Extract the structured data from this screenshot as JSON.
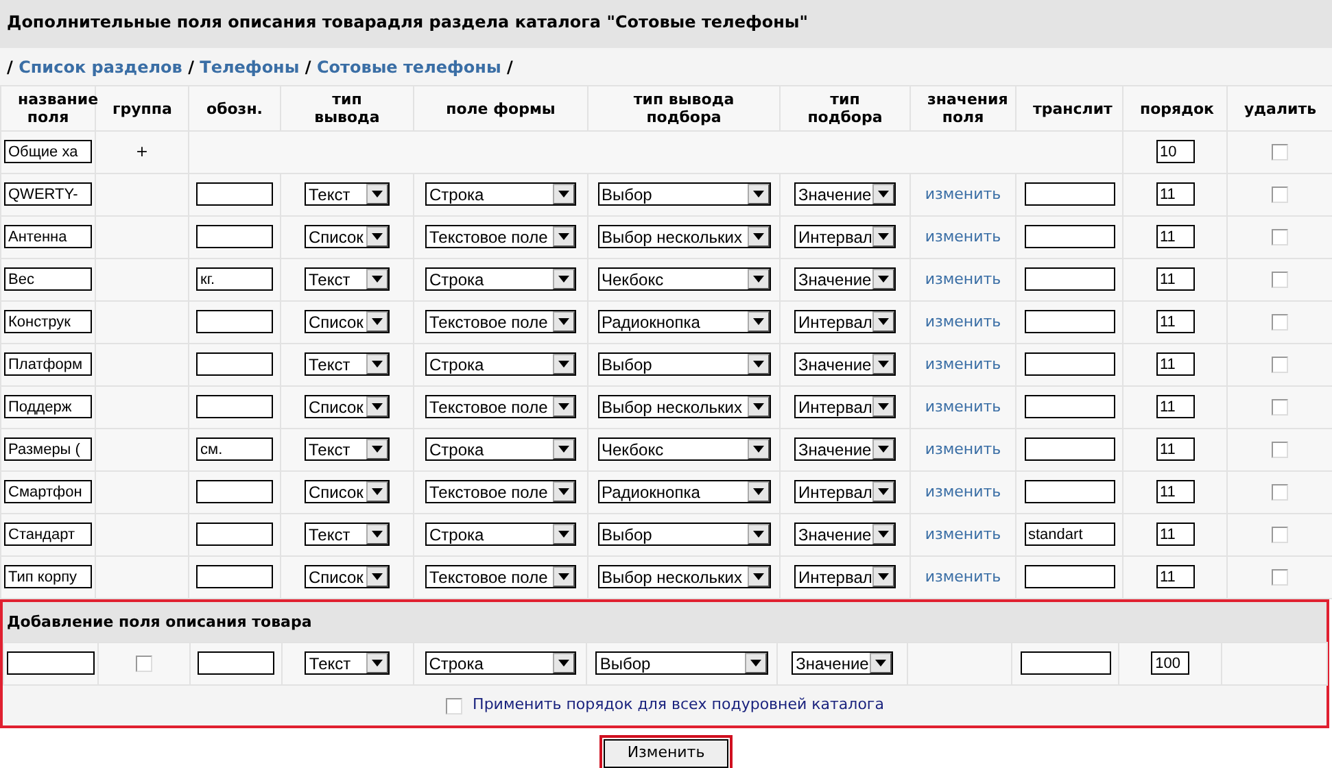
{
  "title": "Дополнительные поля описания товарадля раздела каталога \"Сотовые телефоны\"",
  "breadcrumb": [
    "Список разделов",
    "Телефоны",
    "Сотовые телефоны"
  ],
  "breadcrumb_separator": "/",
  "columns": [
    "название поля",
    "группа",
    "обозн.",
    "тип вывода",
    "поле формы",
    "тип вывода подбора",
    "тип подбора",
    "значения поля",
    "транслит",
    "порядок",
    "удалить"
  ],
  "group_row": {
    "name": "Общие ха",
    "marker": "+",
    "order": "10",
    "delete": false
  },
  "rows": [
    {
      "name": "QWERTY-",
      "output_type": "Текст",
      "form_field": "Строка",
      "filter_output": "Выбор",
      "filter_type": "Значение",
      "values_link": "изменить",
      "order": "11",
      "delete": false
    },
    {
      "name": "Антенна",
      "output_type": "Список",
      "form_field": "Текстовое поле",
      "filter_output": "Выбор нескольких",
      "filter_type": "Интервал",
      "values_link": "изменить",
      "order": "11",
      "delete": false
    },
    {
      "name": "Вес",
      "unit": "кг.",
      "output_type": "Текст",
      "form_field": "Строка",
      "filter_output": "Чекбокс",
      "filter_type": "Значение",
      "values_link": "изменить",
      "order": "11",
      "delete": false
    },
    {
      "name": "Конструк",
      "output_type": "Список",
      "form_field": "Текстовое поле",
      "filter_output": "Радиокнопка",
      "filter_type": "Интервал",
      "values_link": "изменить",
      "order": "11",
      "delete": false
    },
    {
      "name": "Платформ",
      "output_type": "Текст",
      "form_field": "Строка",
      "filter_output": "Выбор",
      "filter_type": "Значение",
      "values_link": "изменить",
      "order": "11",
      "delete": false
    },
    {
      "name": "Поддерж",
      "output_type": "Список",
      "form_field": "Текстовое поле",
      "filter_output": "Выбор нескольких",
      "filter_type": "Интервал",
      "values_link": "изменить",
      "order": "11",
      "delete": false
    },
    {
      "name": "Размеры (",
      "unit": "см.",
      "output_type": "Текст",
      "form_field": "Строка",
      "filter_output": "Чекбокс",
      "filter_type": "Значение",
      "values_link": "изменить",
      "order": "11",
      "delete": false
    },
    {
      "name": "Смартфон",
      "output_type": "Список",
      "form_field": "Текстовое поле",
      "filter_output": "Радиокнопка",
      "filter_type": "Интервал",
      "values_link": "изменить",
      "order": "11",
      "delete": false
    },
    {
      "name": "Стандарт",
      "output_type": "Текст",
      "form_field": "Строка",
      "filter_output": "Выбор",
      "filter_type": "Значение",
      "values_link": "изменить",
      "translit": "standart",
      "order": "11",
      "delete": false
    },
    {
      "name": "Тип корпу",
      "output_type": "Список",
      "form_field": "Текстовое поле",
      "filter_output": "Выбор нескольких",
      "filter_type": "Интервал",
      "values_link": "изменить",
      "order": "11",
      "delete": false
    }
  ],
  "add_section": {
    "title": "Добавление поля описания товара",
    "row": {
      "group": false,
      "output_type": "Текст",
      "form_field": "Строка",
      "filter_output": "Выбор",
      "filter_type": "Значение",
      "order": "100"
    },
    "apply_all": {
      "label": "Применить порядок для всех подуровней каталога",
      "checked": false
    }
  },
  "submit": "Изменить"
}
